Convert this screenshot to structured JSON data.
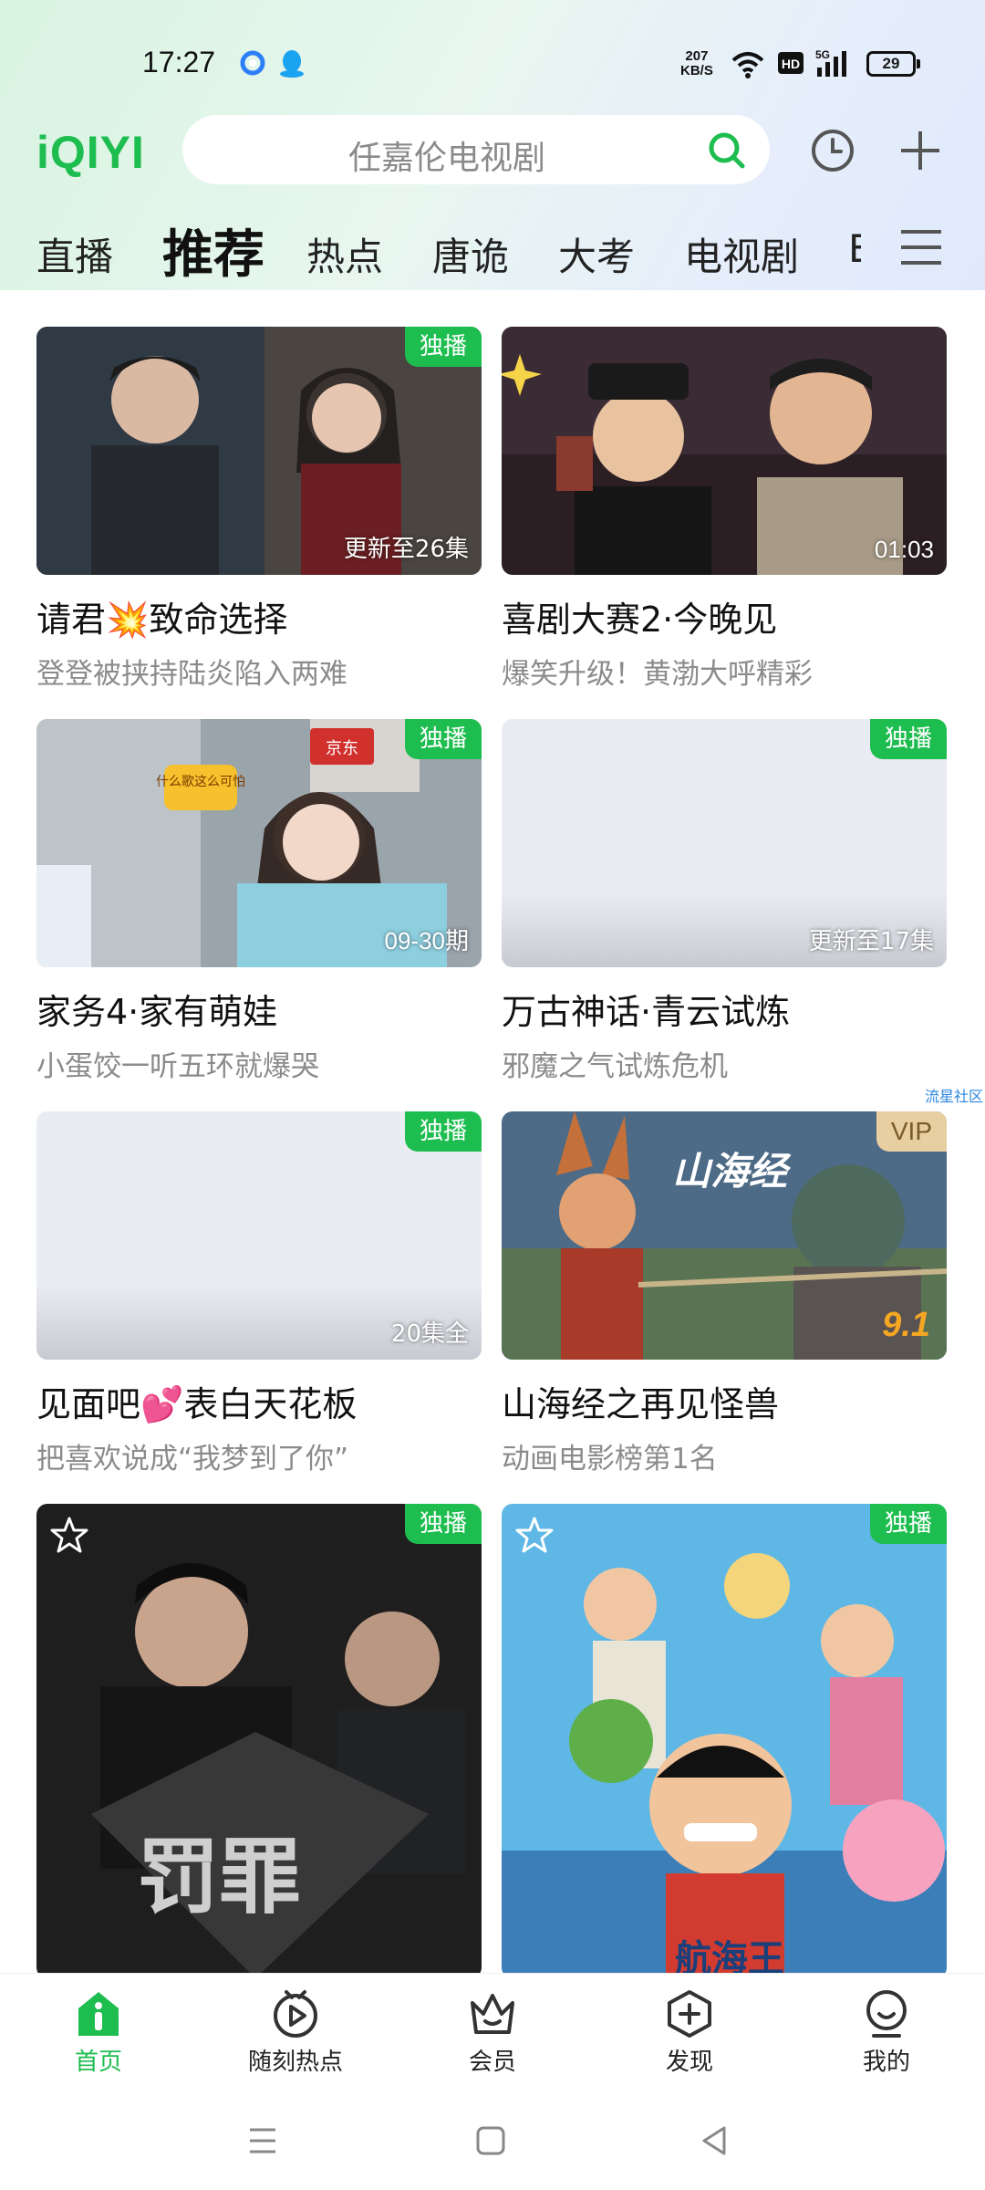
{
  "status_bar": {
    "time": "17:27",
    "net_speed_value": "207",
    "net_speed_unit": "KB/S",
    "hd_label": "HD",
    "signal_label": "5G",
    "battery": "29"
  },
  "app": {
    "logo": "iQIYI",
    "search_placeholder": "任嘉伦电视剧",
    "accent_color": "#1ebd4f"
  },
  "tabs": [
    {
      "label": "直播"
    },
    {
      "label": "推荐",
      "active": true
    },
    {
      "label": "热点"
    },
    {
      "label": "唐诡"
    },
    {
      "label": "大考"
    },
    {
      "label": "电视剧"
    },
    {
      "label": "E"
    }
  ],
  "cards": [
    {
      "title": "请君💥致命选择",
      "subtitle": "登登被挟持陆炎陷入两难",
      "badge": "独播",
      "overlay": "更新至26集"
    },
    {
      "title": "喜剧大赛2·今晚见",
      "subtitle": "爆笑升级！黄渤大呼精彩",
      "overlay": "01:03"
    },
    {
      "title": "家务4·家有萌娃",
      "subtitle": "小蛋饺一听五环就爆哭",
      "badge": "独播",
      "overlay": "09-30期",
      "sticker": "什么歌这么可怕",
      "logo_text": "京东"
    },
    {
      "title": "万古神话·青云试炼",
      "subtitle": "邪魔之气试炼危机",
      "badge": "独播",
      "overlay": "更新至17集"
    },
    {
      "title": "见面吧💕表白天花板",
      "subtitle": "把喜欢说成“我梦到了你”",
      "badge": "独播",
      "overlay": "20集全"
    },
    {
      "title": "山海经之再见怪兽",
      "subtitle": "动画电影榜第1名",
      "badge": "VIP",
      "rating": "9.1",
      "poster_text": "山海经"
    },
    {
      "badge": "独播",
      "poster_text": "罚罪"
    },
    {
      "badge": "独播",
      "poster_text": "航海王"
    }
  ],
  "side_link": "流星社区",
  "bottom_nav": [
    {
      "label": "首页",
      "icon": "home-icon",
      "active": true
    },
    {
      "label": "随刻热点",
      "icon": "play-circle-icon"
    },
    {
      "label": "会员",
      "icon": "crown-icon"
    },
    {
      "label": "发现",
      "icon": "discover-plus-icon"
    },
    {
      "label": "我的",
      "icon": "profile-icon"
    }
  ]
}
